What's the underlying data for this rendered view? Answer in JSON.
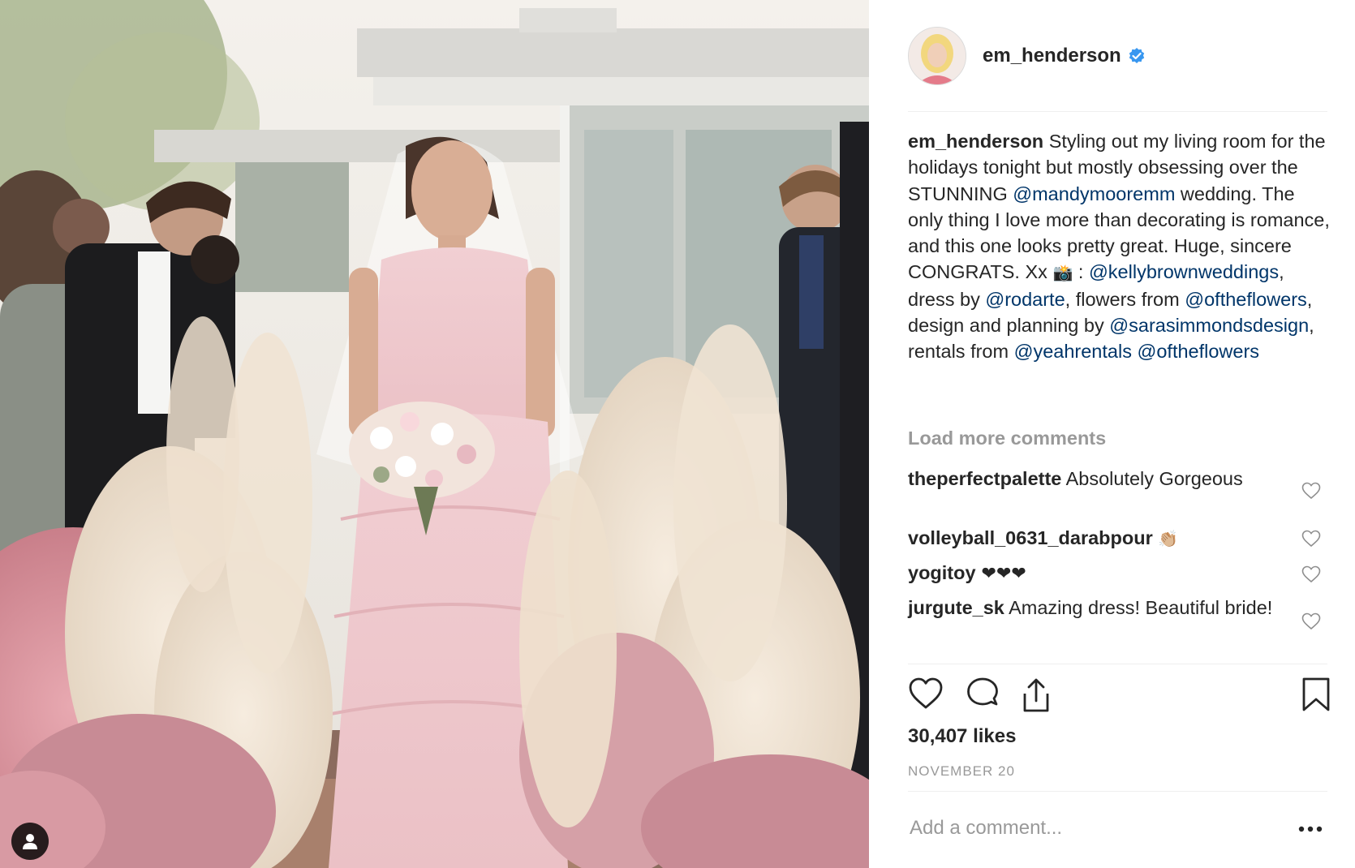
{
  "post": {
    "username": "em_henderson",
    "verified": true,
    "caption_text": [
      " Styling out my living room for the holidays tonight but mostly obsessing over the STUNNING ",
      " wedding. The only thing I love more than decorating is romance, and this one looks pretty great. Huge, sincere CONGRATS. Xx ",
      " : ",
      ", dress by ",
      ", flowers from ",
      ", design and planning by ",
      ", rentals from ",
      " "
    ],
    "mentions": [
      "@mandymooremm",
      "@kellybrownweddings",
      "@rodarte",
      "@oftheflowers",
      "@sarasimmondsdesign",
      "@yeahrentals",
      "@oftheflowers"
    ],
    "camera_emoji": "📸",
    "load_more": "Load more comments",
    "likes": "30,407 likes",
    "date": "NOVEMBER 20",
    "add_comment_placeholder": "Add a comment..."
  },
  "comments": [
    {
      "user": "theperfectpalette",
      "text": " Absolutely Gorgeous"
    },
    {
      "user": "volleyball_0631_darabpour",
      "text": " 👏🏼"
    },
    {
      "user": "yogitoy",
      "text": " ❤❤❤"
    },
    {
      "user": "jurgute_sk",
      "text": " Amazing dress! Beautiful bride!"
    }
  ],
  "icons": {
    "like": "heart-icon",
    "comment": "comment-bubble-icon",
    "share": "share-icon",
    "save": "bookmark-icon",
    "more": "ellipsis-icon",
    "verified": "verified-badge-icon",
    "tag": "person-tag-icon"
  },
  "colors": {
    "text": "#262626",
    "link": "#003569",
    "muted": "#999999",
    "verified": "#3897f0",
    "divider": "#efefef"
  }
}
